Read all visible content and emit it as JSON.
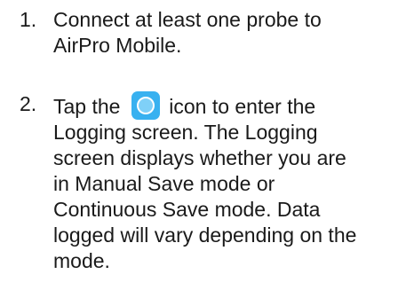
{
  "steps": [
    {
      "number": "1.",
      "lines": [
        "Connect at least one probe to",
        "AirPro Mobile."
      ]
    },
    {
      "number": "2.",
      "first_line_before_icon": "Tap the",
      "icon": "logging-circle-icon",
      "icon_color": "#38b1f0",
      "first_line_after_icon": "icon to enter the",
      "lines": [
        "Logging screen. The Logging",
        "screen displays whether you are",
        "in Manual Save mode or",
        "Continuous Save mode. Data",
        "logged will vary depending on the",
        "mode."
      ]
    }
  ]
}
